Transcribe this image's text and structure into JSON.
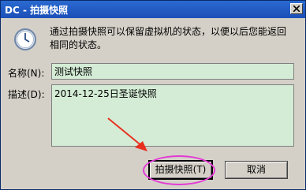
{
  "window": {
    "title": "DC - 拍摄快照"
  },
  "icons": {
    "clock": "clock-icon",
    "close": "close-icon"
  },
  "dialog": {
    "description": "通过拍摄快照可以保留虚拟机的状态，以便以后您能返回相同的状态。",
    "name_label": "名称(N):",
    "name_value": "测试快照",
    "desc_label": "描述(D):",
    "desc_value": "2014-12-25日圣诞快照",
    "take_snapshot_button": "拍摄快照(T)",
    "cancel_button": "取消"
  },
  "annotation": {
    "highlight_color": "#e33ad6",
    "arrow_color": "#e83020"
  }
}
